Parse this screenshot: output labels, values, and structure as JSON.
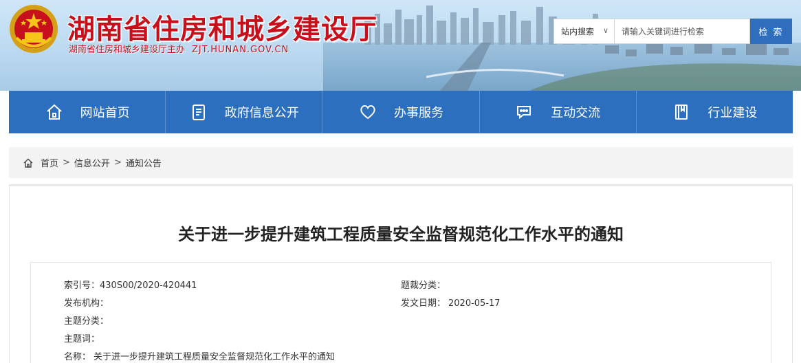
{
  "header": {
    "site_title": "湖南省住房和城乡建设厅",
    "site_subtitle": "湖南省住房和城乡建设厅主办",
    "site_domain": "ZJT.HUNAN.GOV.CN",
    "title_color": "#c8101c"
  },
  "search": {
    "scope_label": "站内搜索",
    "placeholder": "请输入关键词进行检索",
    "button_label": "检 索",
    "button_color": "#2f6ebd"
  },
  "nav": {
    "background_color": "#2b6fbe",
    "items": [
      {
        "label": "网站首页",
        "icon": "home-icon"
      },
      {
        "label": "政府信息公开",
        "icon": "document-icon"
      },
      {
        "label": "办事服务",
        "icon": "heart-icon"
      },
      {
        "label": "互动交流",
        "icon": "chat-icon"
      },
      {
        "label": "行业建设",
        "icon": "book-icon"
      }
    ]
  },
  "breadcrumb": {
    "items": [
      "首页",
      "信息公开",
      "通知公告"
    ],
    "separator": ">"
  },
  "article": {
    "title": "关于进一步提升建筑工程质量安全监督规范化工作水平的通知",
    "meta": {
      "index_label": "索引号：",
      "index_value": "430S00/2020-420441",
      "genre_label": "题裁分类：",
      "genre_value": "",
      "publisher_label": "发布机构：",
      "publisher_value": "",
      "date_label": "发文日期：",
      "date_value": "2020-05-17",
      "topic_label": "主题分类：",
      "topic_value": "",
      "keywords_label": "主题词：",
      "keywords_value": "",
      "name_label": "名称：",
      "name_value": "关于进一步提升建筑工程质量安全监督规范化工作水平的通知"
    }
  }
}
